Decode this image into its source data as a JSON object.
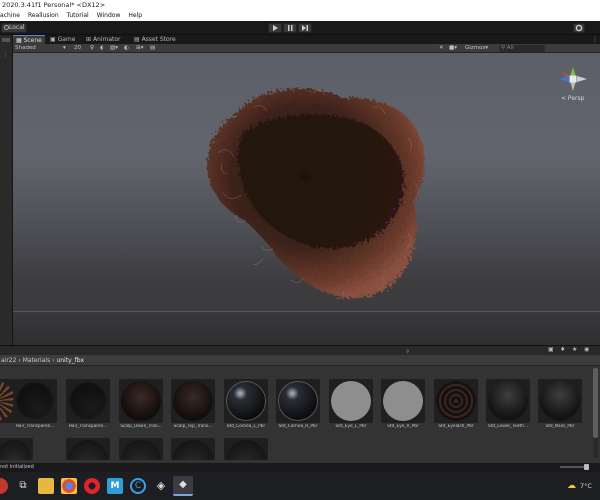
{
  "window": {
    "title": "2020.3.41f1 Personal* <DX12>",
    "menu": [
      "achine",
      "Reallusion",
      "Tutorial",
      "Window",
      "Help"
    ]
  },
  "toolbar": {
    "pivot_label": "Local",
    "play_icon": "play-icon",
    "pause_icon": "pause-icon",
    "step_icon": "step-icon"
  },
  "scene_tabs": [
    {
      "label": "Scene",
      "icon": "scene-icon",
      "active": true
    },
    {
      "label": "Game",
      "icon": "game-icon",
      "active": false
    },
    {
      "label": "Animator",
      "icon": "animator-icon",
      "active": false
    },
    {
      "label": "Asset Store",
      "icon": "store-icon",
      "active": false
    }
  ],
  "scene_toolbar": {
    "draw_mode": "Shaded",
    "mode_2d_value": "20",
    "gizmos_label": "Gizmos",
    "search_placeholder": "All"
  },
  "viewport": {
    "perspective_label": "< Persp"
  },
  "project": {
    "breadcrumb": [
      "air22",
      "Materials",
      "unity_fbx"
    ],
    "assets": [
      {
        "label": "",
        "kind": "hairball"
      },
      {
        "label": "Hair_Transparen...",
        "kind": "dark"
      },
      {
        "label": "Hair_Transparen...",
        "kind": "dark"
      },
      {
        "label": "Scalp_Down_Tran...",
        "kind": "scalp"
      },
      {
        "label": "Scalp_Top_Trans...",
        "kind": "scalp"
      },
      {
        "label": "Std_Cornea_L_Pbr",
        "kind": "glass"
      },
      {
        "label": "Std_Cornea_R_Pbr",
        "kind": "glass"
      },
      {
        "label": "Std_Eye_L_Pbr",
        "kind": "grey"
      },
      {
        "label": "Std_Eye_R_Pbr",
        "kind": "grey"
      },
      {
        "label": "Std_Eyelash_Pbr",
        "kind": "lash"
      },
      {
        "label": "Std_Lower_Teeth...",
        "kind": "teeth"
      },
      {
        "label": "Std_Nails_Pbr",
        "kind": "teeth"
      }
    ],
    "row2_count": 5
  },
  "status": {
    "message": "not initialized"
  },
  "taskbar": {
    "temperature": "7°C"
  }
}
